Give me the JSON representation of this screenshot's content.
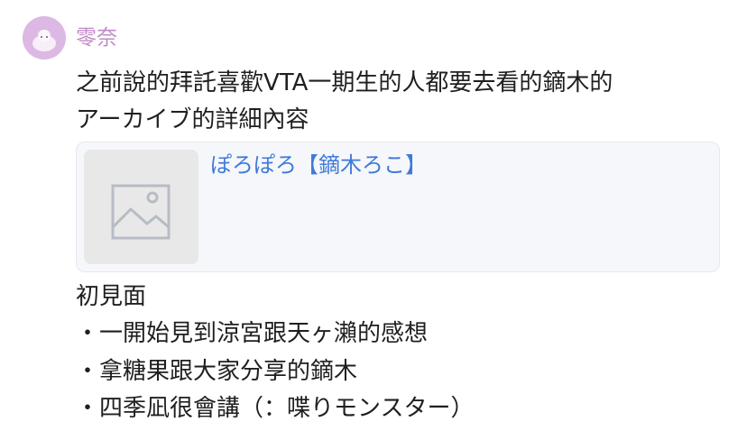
{
  "message": {
    "username": "零奈",
    "lines_top": [
      "之前說的拜託喜歡VTA一期生的人都要去看的鏑木的",
      "アーカイブ的詳細內容"
    ],
    "link_preview": {
      "title": "ぽろぽろ【鏑木ろこ】",
      "thumbnail_icon": "image-placeholder-icon"
    },
    "lines_bottom": [
      "初見面",
      "・一開始見到涼宮跟天ヶ瀨的感想",
      "・拿糖果跟大家分享的鏑木",
      "・四季凪很會講（：喋りモンスター）"
    ]
  },
  "colors": {
    "username": "#c08ac8",
    "link": "#3f7ad8",
    "text": "#1f1f1f",
    "card_bg": "#f6f7fb",
    "thumb_bg": "#e8e8e8"
  }
}
